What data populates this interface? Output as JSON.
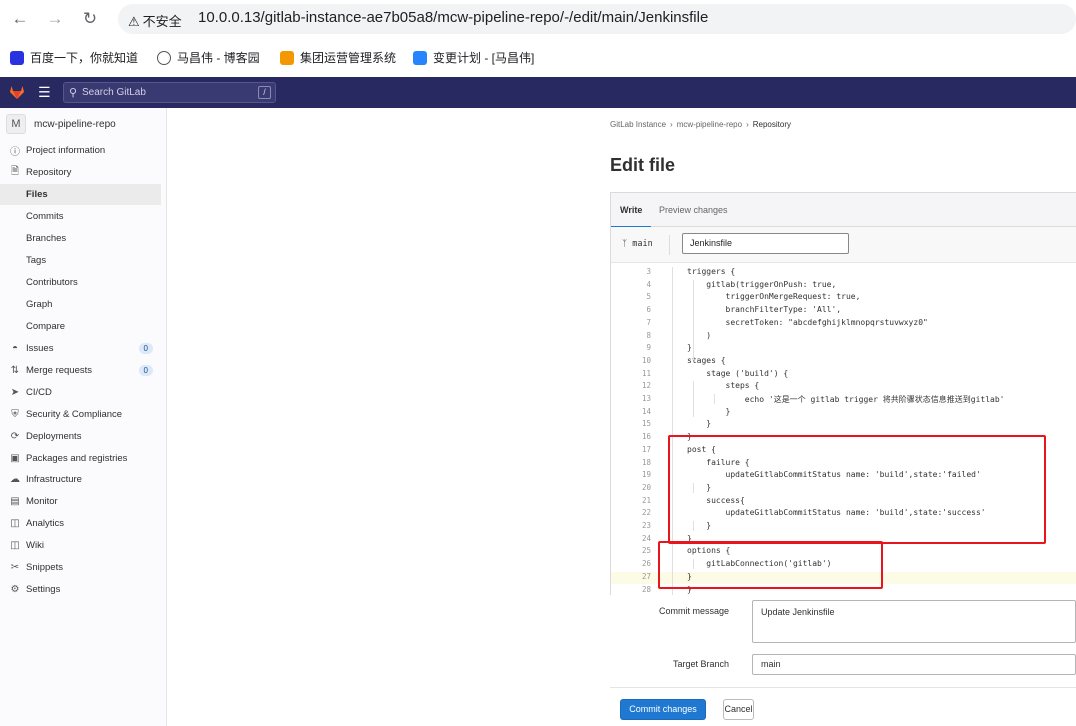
{
  "browser": {
    "security_label": "不安全",
    "url": "10.0.0.13/gitlab-instance-ae7b05a8/mcw-pipeline-repo/-/edit/main/Jenkinsfile"
  },
  "bookmarks": [
    {
      "label": "百度一下，你就知道"
    },
    {
      "label": "马昌伟 - 博客园"
    },
    {
      "label": "集团运营管理系统"
    },
    {
      "label": "变更计划 - [马昌伟]"
    }
  ],
  "header": {
    "search_placeholder": "Search GitLab",
    "search_shortcut": "/"
  },
  "sidebar": {
    "project_avatar": "M",
    "project_name": "mcw-pipeline-repo",
    "items": [
      {
        "label": "Project information"
      },
      {
        "label": "Repository"
      },
      {
        "label": "Files"
      },
      {
        "label": "Commits"
      },
      {
        "label": "Branches"
      },
      {
        "label": "Tags"
      },
      {
        "label": "Contributors"
      },
      {
        "label": "Graph"
      },
      {
        "label": "Compare"
      },
      {
        "label": "Issues",
        "count": "0"
      },
      {
        "label": "Merge requests",
        "count": "0"
      },
      {
        "label": "CI/CD"
      },
      {
        "label": "Security & Compliance"
      },
      {
        "label": "Deployments"
      },
      {
        "label": "Packages and registries"
      },
      {
        "label": "Infrastructure"
      },
      {
        "label": "Monitor"
      },
      {
        "label": "Analytics"
      },
      {
        "label": "Wiki"
      },
      {
        "label": "Snippets"
      },
      {
        "label": "Settings"
      }
    ]
  },
  "breadcrumb": [
    "GitLab Instance",
    "mcw-pipeline-repo",
    "Repository"
  ],
  "page_title": "Edit file",
  "editor": {
    "tab_write": "Write",
    "tab_preview": "Preview changes",
    "branch": "main",
    "filename": "Jenkinsfile",
    "lines": [
      {
        "n": "3",
        "text": "triggers {"
      },
      {
        "n": "4",
        "text": "    gitlab(triggerOnPush: true,"
      },
      {
        "n": "5",
        "text": "        triggerOnMergeRequest: true,"
      },
      {
        "n": "6",
        "text": "        branchFilterType: 'All',"
      },
      {
        "n": "7",
        "text": "        secretToken: \"abcdefghijklmnopqrstuvwxyz0\""
      },
      {
        "n": "8",
        "text": "    )"
      },
      {
        "n": "9",
        "text": "}"
      },
      {
        "n": "10",
        "text": "stages {"
      },
      {
        "n": "11",
        "text": "    stage ('build') {"
      },
      {
        "n": "12",
        "text": "        steps {"
      },
      {
        "n": "13",
        "text": "            echo '这是一个 gitlab trigger 将共阶骤状态信息推送到gitlab'"
      },
      {
        "n": "14",
        "text": "        }"
      },
      {
        "n": "15",
        "text": "    }"
      },
      {
        "n": "16",
        "text": "}"
      },
      {
        "n": "17",
        "text": "post {"
      },
      {
        "n": "18",
        "text": "    failure {"
      },
      {
        "n": "19",
        "text": "        updateGitlabCommitStatus name: 'build',state:'failed'"
      },
      {
        "n": "20",
        "text": "    }"
      },
      {
        "n": "21",
        "text": "    success{"
      },
      {
        "n": "22",
        "text": "        updateGitlabCommitStatus name: 'build',state:'success'"
      },
      {
        "n": "23",
        "text": "    }"
      },
      {
        "n": "24",
        "text": "}"
      },
      {
        "n": "25",
        "text": "options {"
      },
      {
        "n": "26",
        "text": "    gitLabConnection('gitlab')"
      },
      {
        "n": "27",
        "text": "}"
      },
      {
        "n": "28",
        "text": "}"
      }
    ]
  },
  "commit": {
    "message_label": "Commit message",
    "message_value": "Update Jenkinsfile",
    "target_label": "Target Branch",
    "target_value": "main",
    "commit_button": "Commit changes",
    "cancel_button": "Cancel"
  },
  "colors": {
    "header_bg": "#292961",
    "primary": "#1f78d1",
    "highlight_box": "#e8151c"
  }
}
